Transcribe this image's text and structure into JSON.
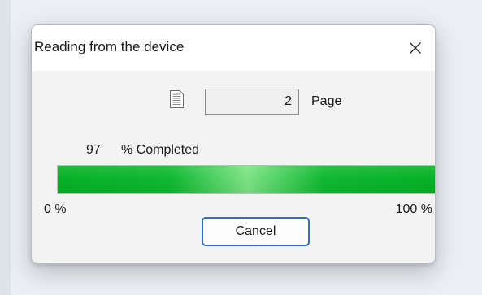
{
  "dialog": {
    "title": "Reading from the device",
    "page_icon": "document-icon",
    "page_value": "2",
    "page_label": "Page",
    "percent_value": "97",
    "percent_label": "% Completed",
    "progress_fraction": 0.97,
    "scale_min": "0 %",
    "scale_max": "100 %",
    "cancel_label": "Cancel"
  },
  "colors": {
    "progress_green": "#06b025",
    "focus_blue": "#2a6fd6"
  }
}
